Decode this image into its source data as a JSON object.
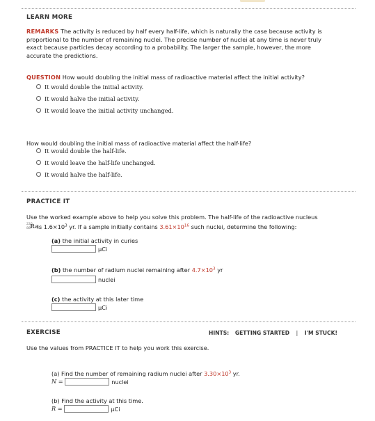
{
  "learn_more": {
    "heading": "LEARN MORE",
    "remarks_label": "REMARKS",
    "remarks_lines": [
      "The activity is reduced by half every half-life, which is naturally the case because activity is",
      "proportional to the number of remaining nuclei. The precise number of nuclei at any time is never truly",
      "exact because particles decay according to a probability. The larger the sample, however, the more",
      "accurate the predictions."
    ],
    "question_label": "QUESTION",
    "question1": "How would doubling the initial mass of radioactive material affect the initial activity?",
    "q1_options": [
      "It would double the initial activity.",
      "It would halve the initial activity.",
      "It would leave the initial activity unchanged."
    ],
    "question2": "How would doubling the initial mass of radioactive material affect the half-life?",
    "q2_options": [
      "It would double the half-life.",
      "It would leave the half-life unchanged.",
      "It would halve the half-life."
    ]
  },
  "practice_it": {
    "heading": "PRACTICE IT",
    "intro": "Use the worked example above to help you solve this problem. The half-life of the radioactive nucleus",
    "isotope": {
      "mass": "226",
      "atomic": "88",
      "symbol": "Ra"
    },
    "line2_a": "is 1.6",
    "line2_mult": "×",
    "line2_base": "10",
    "line2_exp": "3",
    "line2_b": "yr. If a sample initially contains",
    "n0_mant": "3.61",
    "n0_mult": "×",
    "n0_base": "10",
    "n0_exp": "16",
    "line2_c": "such nuclei, determine the following:",
    "part_a_letter": "(a)",
    "part_a_text": "the initial activity in curies",
    "part_a_unit": "µCi",
    "part_b_letter": "(b)",
    "part_b_text": "the number of radium nuclei remaining after",
    "part_b_t_mant": "4.7",
    "part_b_mult": "×",
    "part_b_base": "10",
    "part_b_exp": "3",
    "part_b_t_unit": "yr",
    "part_b_unit": "nuclei",
    "part_c_letter": "(c)",
    "part_c_text": "the activity at this later time",
    "part_c_unit": "µCi"
  },
  "exercise": {
    "heading": "EXERCISE",
    "hints_label": "HINTS:",
    "hint_getting_started": "GETTING STARTED",
    "hint_separator": "|",
    "hint_stuck": "I'M STUCK!",
    "intro": "Use the values from PRACTICE IT to help you work this exercise.",
    "part_a": "(a) Find the number of remaining radium nuclei after",
    "part_a_mant": "3.30",
    "part_a_mult": "×",
    "part_a_base": "10",
    "part_a_exp": "3",
    "part_a_tail": "yr.",
    "var_n": "N",
    "eq": "=",
    "part_a_unit": "nuclei",
    "part_b": "(b) Find the activity at this time.",
    "var_r": "R",
    "part_b_unit": "µCi"
  }
}
